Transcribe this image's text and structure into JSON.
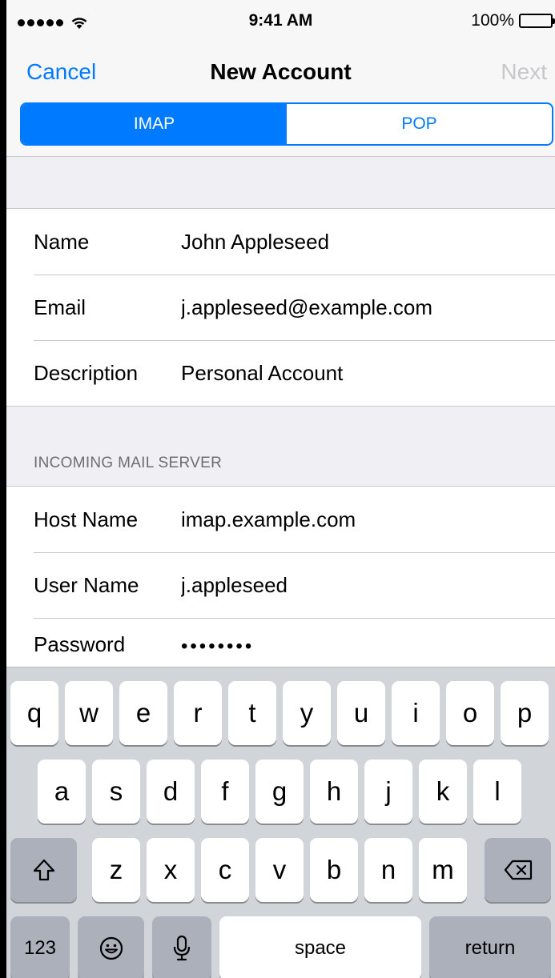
{
  "status_bar": {
    "time": "9:41 AM",
    "battery_percent": "100%",
    "signal_bars": 5,
    "icons": [
      "signal-dots-icon",
      "wifi-icon",
      "battery-icon"
    ]
  },
  "nav": {
    "cancel_label": "Cancel",
    "title": "New Account",
    "next_label": "Next"
  },
  "segmented": {
    "options": [
      "IMAP",
      "POP"
    ],
    "selected": "IMAP"
  },
  "account": {
    "name_label": "Name",
    "name_value": "John Appleseed",
    "email_label": "Email",
    "email_value": "j.appleseed@example.com",
    "description_label": "Description",
    "description_value": "Personal Account"
  },
  "incoming": {
    "header": "INCOMING MAIL SERVER",
    "host_label": "Host Name",
    "host_value": "imap.example.com",
    "user_label": "User Name",
    "user_value": "j.appleseed",
    "password_label": "Password",
    "password_value": "••••••••"
  },
  "keyboard": {
    "row1": [
      "q",
      "w",
      "e",
      "r",
      "t",
      "y",
      "u",
      "i",
      "o",
      "p"
    ],
    "row2": [
      "a",
      "s",
      "d",
      "f",
      "g",
      "h",
      "j",
      "k",
      "l"
    ],
    "row3": [
      "z",
      "x",
      "c",
      "v",
      "b",
      "n",
      "m"
    ],
    "numbers_label": "123",
    "space_label": "space",
    "return_label": "return",
    "icons": [
      "shift-icon",
      "backspace-icon",
      "emoji-icon",
      "microphone-icon"
    ]
  },
  "colors": {
    "accent": "#007aff",
    "disabled": "#c7c7cc",
    "background": "#efeff4",
    "keyboard": "#d1d4d9",
    "dark_key": "#abb0ba"
  }
}
